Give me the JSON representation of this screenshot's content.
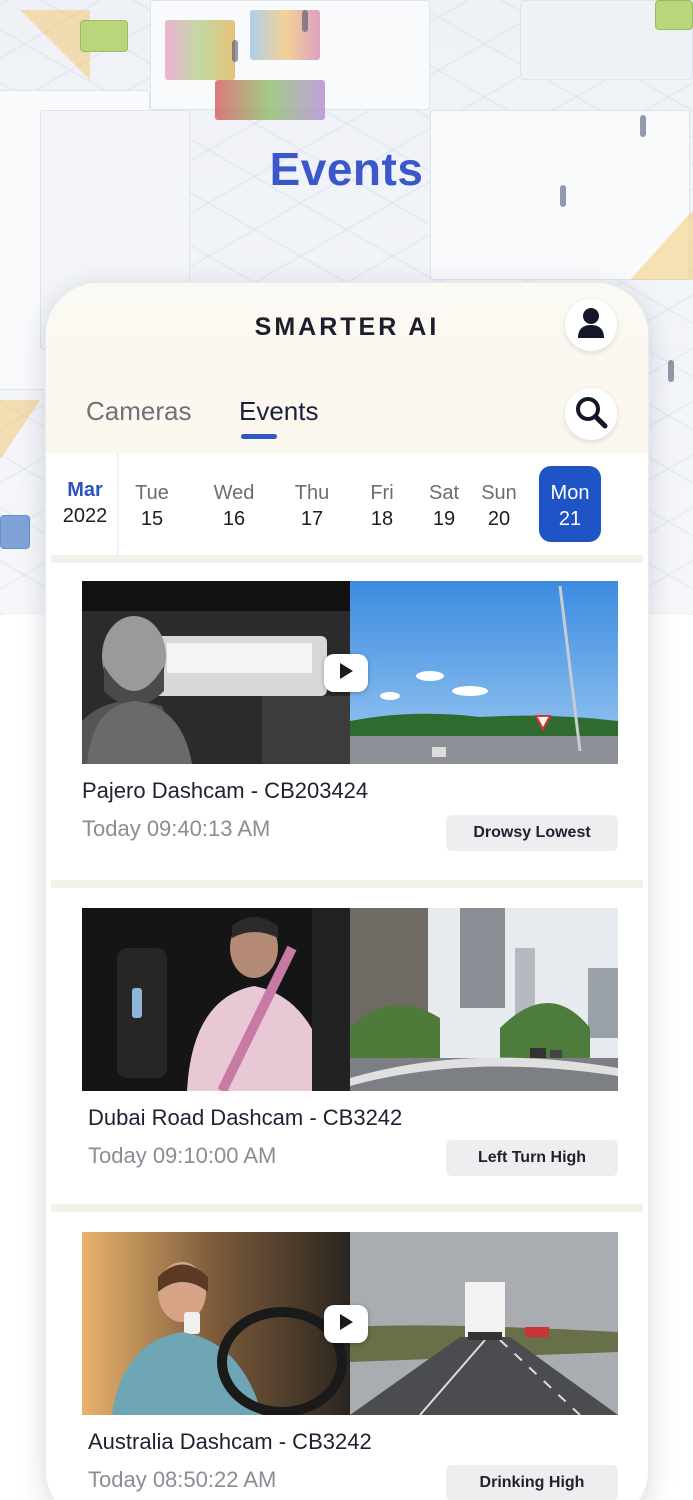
{
  "page": {
    "title": "Events"
  },
  "header": {
    "logo_text": "SMARTER AI",
    "profile_icon": "user-icon",
    "search_icon": "search-icon"
  },
  "tabs": [
    {
      "label": "Cameras",
      "active": false
    },
    {
      "label": "Events",
      "active": true
    }
  ],
  "date_strip": {
    "month": "Mar",
    "year": "2022",
    "days": [
      {
        "name": "Tue",
        "date": "15",
        "active": false
      },
      {
        "name": "Wed",
        "date": "16",
        "active": false
      },
      {
        "name": "Thu",
        "date": "17",
        "active": false
      },
      {
        "name": "Fri",
        "date": "18",
        "active": false
      },
      {
        "name": "Sat",
        "date": "19",
        "active": false
      },
      {
        "name": "Sun",
        "date": "20",
        "active": false
      },
      {
        "name": "Mon",
        "date": "21",
        "active": true
      }
    ]
  },
  "events": [
    {
      "title": "Pajero Dashcam - CB203424",
      "time": "Today 09:40:13 AM",
      "tag": "Drowsy Lowest",
      "has_play": true
    },
    {
      "title": "Dubai Road Dashcam - CB3242",
      "time": "Today 09:10:00 AM",
      "tag": "Left Turn High",
      "has_play": false
    },
    {
      "title": "Australia Dashcam - CB3242",
      "time": "Today 08:50:22 AM",
      "tag": "Drinking High",
      "has_play": true
    }
  ],
  "colors": {
    "accent": "#1f54c6",
    "title": "#3b58c9",
    "logo_slash": "#e23b3b"
  }
}
